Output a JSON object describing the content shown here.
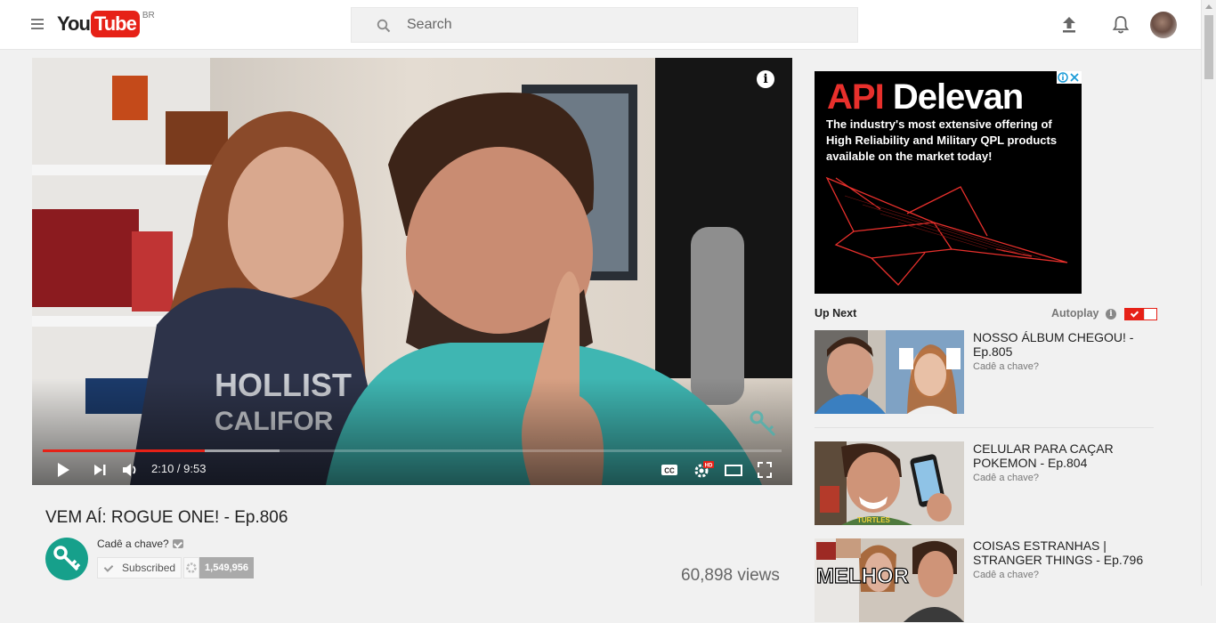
{
  "masthead": {
    "logo_you": "You",
    "logo_tube": "Tube",
    "country": "BR",
    "search_placeholder": "Search"
  },
  "player": {
    "time_current": "2:10",
    "time_duration": "9:53",
    "time_display": "2:10 / 9:53",
    "progress_fraction": 0.219,
    "buffered_fraction": 0.32,
    "info_label": "i",
    "hd_badge": "HD"
  },
  "video": {
    "title": "VEM AÍ: ROGUE ONE! - Ep.806",
    "channel": "Cadê a chave?",
    "subscribe_label": "Subscribed",
    "subscriber_count": "1,549,956",
    "views": "60,898 views"
  },
  "ad": {
    "brand_api": "API",
    "brand_name": "Delevan",
    "copy": "The industry's most extensive offering of High Reliability and Military QPL products available on the market today!",
    "adchoice_label": "ⓘ✕"
  },
  "sidebar": {
    "up_next_label": "Up Next",
    "autoplay_label": "Autoplay",
    "autoplay_on": true,
    "items": [
      {
        "title": "NOSSO ÁLBUM CHEGOU! - Ep.805",
        "channel": "Cadê a chave?"
      },
      {
        "title": "CELULAR PARA CAÇAR POKEMON - Ep.804",
        "channel": "Cadê a chave?"
      },
      {
        "title": "COISAS ESTRANHAS | STRANGER THINGS - Ep.796",
        "channel": "Cadê a chave?",
        "thumb_text": "MELHOR"
      }
    ]
  },
  "colors": {
    "brand_red": "#e62117",
    "channel_teal": "#16a08b",
    "ad_red": "#e8302c"
  }
}
